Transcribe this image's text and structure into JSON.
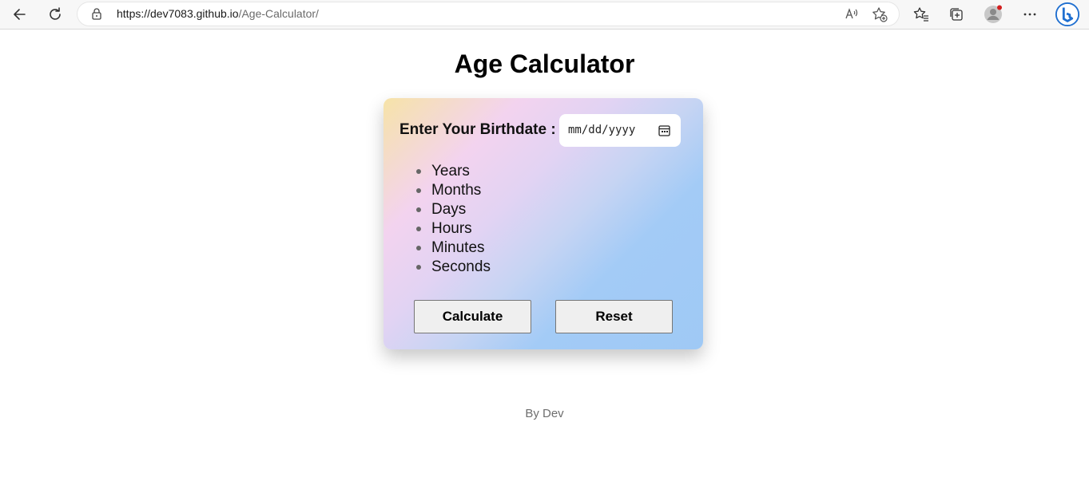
{
  "browser": {
    "url_host": "https://dev7083.github.io",
    "url_path": "/Age-Calculator/",
    "icons": [
      "back-icon",
      "refresh-icon",
      "lock-icon",
      "read-aloud-icon",
      "add-favorite-icon",
      "favorites-icon",
      "collections-icon",
      "profile-avatar",
      "more-icon",
      "bing-icon"
    ]
  },
  "page": {
    "title": "Age Calculator",
    "birthdate_label": "Enter Your Birthdate :",
    "date_placeholder": "mm/dd/yyyy",
    "units": [
      "Years",
      "Months",
      "Days",
      "Hours",
      "Minutes",
      "Seconds"
    ],
    "calculate_label": "Calculate",
    "reset_label": "Reset",
    "footer": "By Dev"
  },
  "colors": {
    "gradient": [
      "#f6e3a8",
      "#f3d3ef",
      "#a3cbf6"
    ],
    "button_bg": "#efefef"
  }
}
